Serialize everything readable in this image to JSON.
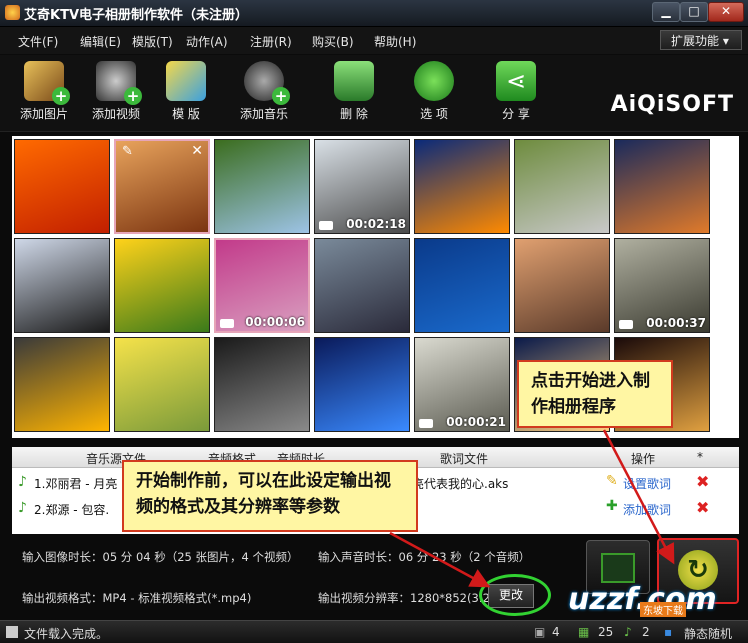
{
  "window": {
    "title": "艾奇KTV电子相册制作软件（未注册）"
  },
  "menu": [
    "文件(F)",
    "编辑(E)",
    "模版(T)",
    "动作(A)",
    "注册(R)",
    "购买(B)",
    "帮助(H)"
  ],
  "ext_label": "扩展功能",
  "toolbar": [
    {
      "label": "添加图片",
      "icon": "add-image-icon"
    },
    {
      "label": "添加视频",
      "icon": "add-video-icon"
    },
    {
      "label": "模 版",
      "icon": "template-icon"
    },
    {
      "label": "添加音乐",
      "icon": "add-music-icon"
    },
    {
      "label": "删 除",
      "icon": "delete-icon"
    },
    {
      "label": "选 项",
      "icon": "options-icon"
    },
    {
      "label": "分 享",
      "icon": "share-icon"
    }
  ],
  "brand": "AiQiSOFT",
  "thumbnails": [
    {
      "colors": [
        "#ff6a00",
        "#c21f00"
      ],
      "duration": ""
    },
    {
      "colors": [
        "#e8a35c",
        "#7b3410"
      ],
      "duration": "",
      "selected": true
    },
    {
      "colors": [
        "#3b6d1e",
        "#9dc3e6"
      ],
      "duration": ""
    },
    {
      "colors": [
        "#d9e0e6",
        "#4a4a4a"
      ],
      "duration": "00:02:18",
      "video": true
    },
    {
      "colors": [
        "#0a2a7a",
        "#ff8a00"
      ],
      "duration": ""
    },
    {
      "colors": [
        "#6e8c3e",
        "#c8c8c8"
      ],
      "duration": ""
    },
    {
      "colors": [
        "#1a2a5c",
        "#e07a2a"
      ],
      "duration": ""
    },
    {
      "colors": [
        "#cfd8e8",
        "#1a1a1a"
      ],
      "duration": ""
    },
    {
      "colors": [
        "#ffd21a",
        "#3a7a1a"
      ],
      "duration": ""
    },
    {
      "colors": [
        "#c23a8a",
        "#d9a0c0"
      ],
      "duration": "00:00:06",
      "video": true,
      "selected": true
    },
    {
      "colors": [
        "#7a8a9a",
        "#2a2a3a"
      ],
      "duration": ""
    },
    {
      "colors": [
        "#0a3a8a",
        "#1a6acc"
      ],
      "duration": ""
    },
    {
      "colors": [
        "#e0a070",
        "#5a3a2a"
      ],
      "duration": ""
    },
    {
      "colors": [
        "#b0b0a0",
        "#3a3a30"
      ],
      "duration": "00:00:37",
      "video": true
    },
    {
      "colors": [
        "#3a3a3a",
        "#ffb400"
      ],
      "duration": ""
    },
    {
      "colors": [
        "#f5e24a",
        "#7a9a3a"
      ],
      "duration": ""
    },
    {
      "colors": [
        "#1a1a1a",
        "#8a8a8a"
      ],
      "duration": ""
    },
    {
      "colors": [
        "#0a1a5a",
        "#3a8aff"
      ],
      "duration": ""
    },
    {
      "colors": [
        "#dadad0",
        "#5a5a50"
      ],
      "duration": "00:00:21",
      "video": true
    },
    {
      "colors": [
        "#0a1a4a",
        "#ffd080"
      ],
      "duration": ""
    },
    {
      "colors": [
        "#1a0a0a",
        "#e0a040"
      ],
      "duration": ""
    }
  ],
  "music_table": {
    "headers": [
      "音乐源文件",
      "音频格式",
      "音频时长",
      "歌词文件",
      "操作",
      "*"
    ],
    "rows": [
      {
        "file": "1.邓丽君 - 月亮",
        "lyrics": "亮代表我的心.aks",
        "action": "设置歌词"
      },
      {
        "file": "2.郑源 - 包容.",
        "lyrics": "",
        "action": "添加歌词"
      }
    ]
  },
  "info": {
    "image_duration": "输入图像时长：05 分 04 秒（25 张图片，4 个视频）",
    "audio_duration": "输入声音时长：06 分 23 秒（2 个音频）",
    "video_format": "输出视频格式：MP4 - 标准视频格式(*.mp4)",
    "resolution": "输出视频分辨率：1280*852(3:2",
    "change_label": "更改"
  },
  "callouts": {
    "start": "点击开始进入制作相册程序",
    "format": "开始制作前，可以在此设定输出视频的格式及其分辨率等参数"
  },
  "status": {
    "text": "文件载入完成。",
    "count_a": "4",
    "count_b": "25",
    "count_c": "2",
    "mode": "静态随机"
  },
  "watermark": {
    "main": "uzzf.com",
    "sub": "东坡下载"
  }
}
